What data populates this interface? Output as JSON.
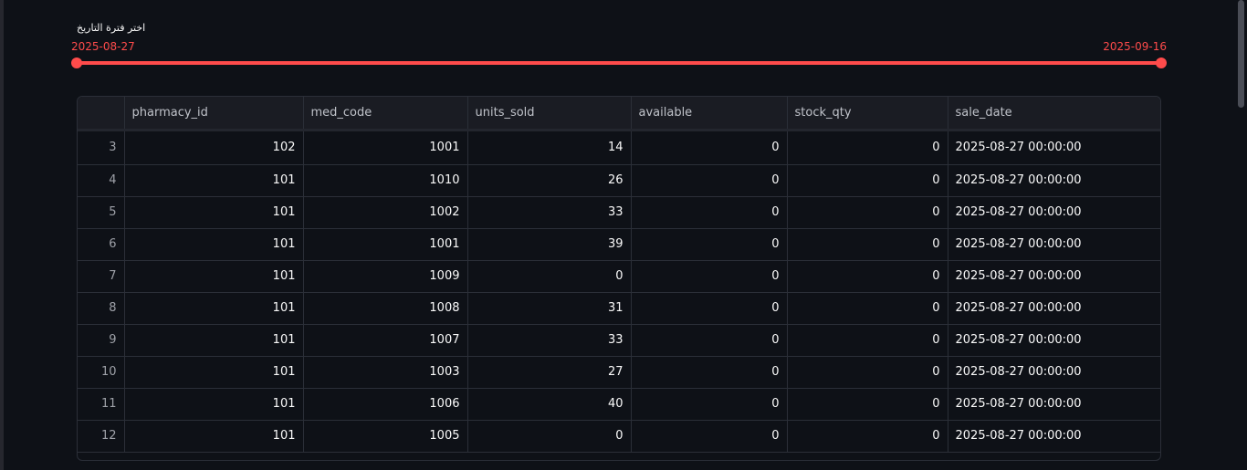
{
  "slider": {
    "label": "اختر فترة التاريخ",
    "min_value": "2025-08-27",
    "max_value": "2025-09-16",
    "accent_color": "#ff4b4b"
  },
  "table": {
    "columns": [
      "",
      "pharmacy_id",
      "med_code",
      "units_sold",
      "available",
      "stock_qty",
      "sale_date"
    ],
    "rows": [
      {
        "index": "3",
        "pharmacy_id": "102",
        "med_code": "1001",
        "units_sold": "14",
        "available": "0",
        "stock_qty": "0",
        "sale_date": "2025-08-27 00:00:00"
      },
      {
        "index": "4",
        "pharmacy_id": "101",
        "med_code": "1010",
        "units_sold": "26",
        "available": "0",
        "stock_qty": "0",
        "sale_date": "2025-08-27 00:00:00"
      },
      {
        "index": "5",
        "pharmacy_id": "101",
        "med_code": "1002",
        "units_sold": "33",
        "available": "0",
        "stock_qty": "0",
        "sale_date": "2025-08-27 00:00:00"
      },
      {
        "index": "6",
        "pharmacy_id": "101",
        "med_code": "1001",
        "units_sold": "39",
        "available": "0",
        "stock_qty": "0",
        "sale_date": "2025-08-27 00:00:00"
      },
      {
        "index": "7",
        "pharmacy_id": "101",
        "med_code": "1009",
        "units_sold": "0",
        "available": "0",
        "stock_qty": "0",
        "sale_date": "2025-08-27 00:00:00"
      },
      {
        "index": "8",
        "pharmacy_id": "101",
        "med_code": "1008",
        "units_sold": "31",
        "available": "0",
        "stock_qty": "0",
        "sale_date": "2025-08-27 00:00:00"
      },
      {
        "index": "9",
        "pharmacy_id": "101",
        "med_code": "1007",
        "units_sold": "33",
        "available": "0",
        "stock_qty": "0",
        "sale_date": "2025-08-27 00:00:00"
      },
      {
        "index": "10",
        "pharmacy_id": "101",
        "med_code": "1003",
        "units_sold": "27",
        "available": "0",
        "stock_qty": "0",
        "sale_date": "2025-08-27 00:00:00"
      },
      {
        "index": "11",
        "pharmacy_id": "101",
        "med_code": "1006",
        "units_sold": "40",
        "available": "0",
        "stock_qty": "0",
        "sale_date": "2025-08-27 00:00:00"
      },
      {
        "index": "12",
        "pharmacy_id": "101",
        "med_code": "1005",
        "units_sold": "0",
        "available": "0",
        "stock_qty": "0",
        "sale_date": "2025-08-27 00:00:00"
      }
    ]
  }
}
